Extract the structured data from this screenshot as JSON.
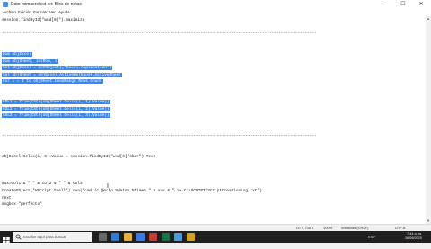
{
  "window": {
    "title": "Dato mimacrotest.txt: Bloc de notas",
    "minimize": "–",
    "maximize": "☐",
    "close": "✕"
  },
  "menu": [
    "Archivo",
    "Edición",
    "Formato",
    "Ver",
    "Ayuda"
  ],
  "editor": {
    "lines": [
      {
        "text": "session.findById(\"wnd[0]\").maximize",
        "selected": false
      },
      {
        "text": "",
        "selected": false
      },
      {
        "text": "-------------------------------------------------------------------------------------------------------------------------------------",
        "selected": false
      },
      {
        "text": "",
        "selected": false
      },
      {
        "text": "",
        "selected": false
      },
      {
        "text": "Dim objExcel",
        "selected": true
      },
      {
        "text": "Dim objSheet, intRow, i",
        "selected": true
      },
      {
        "text": "Set objExcel = GetObject(,\"Excel.Application\")",
        "selected": true
      },
      {
        "text": "Set objSheet = objExcel.ActiveWorkbook.ActiveSheet",
        "selected": true
      },
      {
        "text": "For i = 2 to objSheet.UsedRange.Rows.Count",
        "selected": true
      },
      {
        "text": "",
        "selected": false
      },
      {
        "text": "",
        "selected": false
      },
      {
        "text": "COL1 = Trim(CStr(objSheet.Cells(i, 1).Value))",
        "selected": true
      },
      {
        "text": "COL2 = Trim(CStr(objSheet.Cells(i, 2).Value))",
        "selected": true
      },
      {
        "text": "COL3 = Trim(CStr(objSheet.Cells(i, 3).Value))",
        "selected": true
      },
      {
        "text": "",
        "selected": false
      },
      {
        "text": "",
        "selected": false
      },
      {
        "text": "-------------------------------------------------------------------------------------------------------------------------------------",
        "selected": false
      },
      {
        "text": "",
        "selected": false
      },
      {
        "text": "",
        "selected": false
      },
      {
        "text": "objExcel.Cells(i, 6).Value = session.findById(\"wnd[0]/sbar\").Text",
        "selected": false
      },
      {
        "text": "",
        "selected": false
      },
      {
        "text": "",
        "selected": false
      },
      {
        "text": "",
        "selected": false
      },
      {
        "text": "aux=col1 & \" \" & col2 & \" \" & col3",
        "selected": false
      },
      {
        "text": "CreateObject(\"WScript.Shell\").run(\"cmd /c @echo %date% %time% \" & aux & \" >> C:\\SCRIPT\\SCriptCreationLog.txt\")",
        "selected": false
      },
      {
        "text": "next",
        "selected": false
      },
      {
        "text": "msgbox \"perfecto\"",
        "selected": false
      }
    ]
  },
  "status": {
    "position": "Ln 7, Col 1",
    "zoom": "100%",
    "line_ending": "Windows (CRLF)",
    "encoding": "UTF-8"
  },
  "taskbar": {
    "search_placeholder": "Escribe aquí para buscar",
    "tray_text": "ESP",
    "time": "7:44 a. m.",
    "date": "26/08/2020"
  },
  "colors": {
    "selection": "#3b86e6",
    "taskbar": "#1f1f1f"
  }
}
